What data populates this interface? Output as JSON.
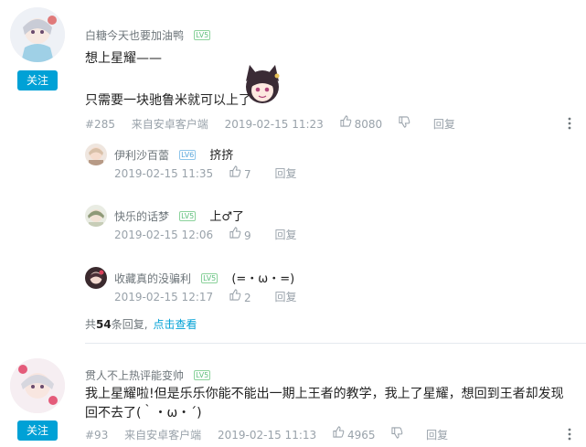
{
  "comment1": {
    "username": "白糖今天也要加油鸭",
    "level": "LV5",
    "text_line1": "想上星耀——",
    "text_line2": "只需要一块驰鲁米就可以上了",
    "floor": "#285",
    "source": "来自安卓客户端",
    "time": "2019-02-15 11:23",
    "likes": "8080",
    "reply_label": "回复",
    "follow_label": "关注"
  },
  "replies": [
    {
      "username": "伊利沙百蕾",
      "level": "LV6",
      "text": "挤挤",
      "time": "2019-02-15 11:35",
      "likes": "7",
      "reply_label": "回复"
    },
    {
      "username": "快乐的话梦",
      "level": "LV5",
      "text": "上♂了",
      "time": "2019-02-15 12:06",
      "likes": "9",
      "reply_label": "回复"
    },
    {
      "username": "收藏真的没骗利",
      "level": "LV5",
      "text": "(=・ω・=)",
      "time": "2019-02-15 12:17",
      "likes": "2",
      "reply_label": "回复"
    }
  ],
  "more_replies": {
    "prefix": "共",
    "count": "54",
    "suffix": "条回复,",
    "link": "点击查看"
  },
  "comment2": {
    "username": "贯人不上热评能变帅",
    "level": "LV5",
    "text": "我上星耀啦!但是乐乐你能不能出一期上王者的教学，我上了星耀，想回到王者却发现回不去了(｀・ω・´)",
    "floor": "#93",
    "source": "来自安卓客户端",
    "time": "2019-02-15 11:13",
    "likes": "4965",
    "reply_label": "回复",
    "follow_label": "关注"
  },
  "colors": {
    "accent": "#00a1d6",
    "meta": "#99a2aa",
    "level_green": "#5fbf7d",
    "level_blue": "#5aa6da"
  }
}
